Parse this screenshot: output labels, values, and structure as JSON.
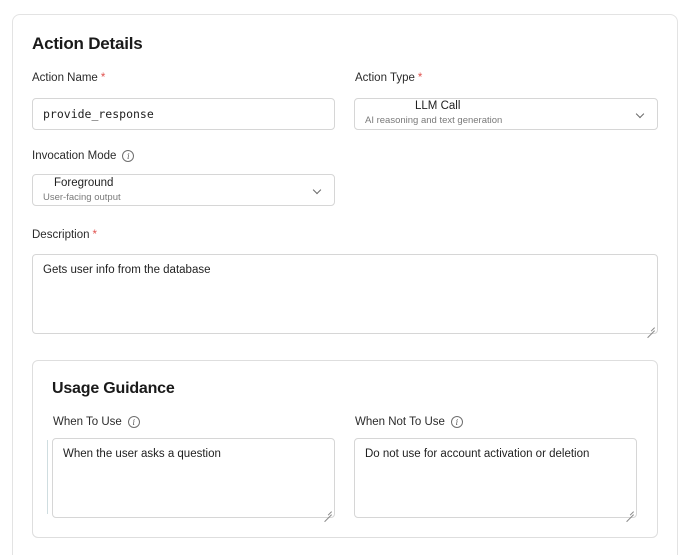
{
  "section": {
    "title": "Action Details"
  },
  "action_name": {
    "label": "Action Name",
    "required_mark": "*",
    "value": "provide_response"
  },
  "action_type": {
    "label": "Action Type",
    "required_mark": "*",
    "selected": "LLM Call",
    "selected_description": "AI reasoning and text generation"
  },
  "invocation_mode": {
    "label": "Invocation Mode",
    "info_icon": "info-icon",
    "selected": "Foreground",
    "selected_description": "User-facing output"
  },
  "description": {
    "label": "Description",
    "required_mark": "*",
    "value": "Gets user info from the database"
  },
  "usage_guidance": {
    "title": "Usage Guidance",
    "when_to_use": {
      "label": "When To Use",
      "value": "When the user asks a question"
    },
    "when_not_to_use": {
      "label": "When Not To Use",
      "value": "Do not use for account activation or deletion"
    }
  },
  "colors": {
    "required": "#e0524f",
    "border": "#d6d6d6",
    "text": "#1f1f1f",
    "muted": "#7a7a7a"
  }
}
